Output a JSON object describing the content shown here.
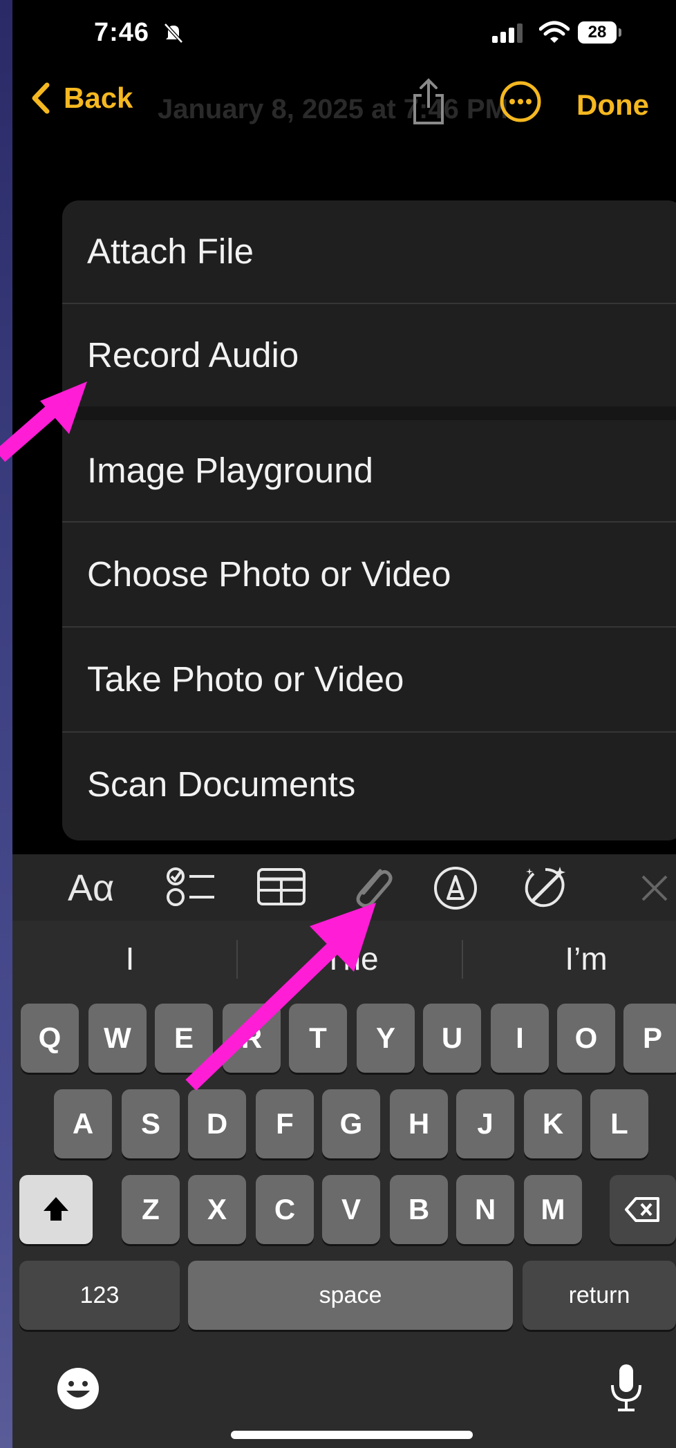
{
  "status_bar": {
    "time": "7:46",
    "battery": "28"
  },
  "nav": {
    "back_label": "Back",
    "title_behind": "January 8, 2025 at 7:46 PM",
    "done_label": "Done"
  },
  "menu": {
    "items": [
      "Attach File",
      "Record Audio",
      "Image Playground",
      "Choose Photo or Video",
      "Take Photo or Video",
      "Scan Documents"
    ]
  },
  "keyboard": {
    "toolbar": {
      "format_label": "Aα",
      "icons": [
        "checklist-icon",
        "table-icon",
        "paperclip-icon",
        "markup-icon",
        "writing-tools-icon",
        "close-icon"
      ]
    },
    "suggestions": [
      "I",
      "The",
      "I’m"
    ],
    "row1": [
      "Q",
      "W",
      "E",
      "R",
      "T",
      "Y",
      "U",
      "I",
      "O",
      "P"
    ],
    "row2": [
      "A",
      "S",
      "D",
      "F",
      "G",
      "H",
      "J",
      "K",
      "L"
    ],
    "row3": [
      "Z",
      "X",
      "C",
      "V",
      "B",
      "N",
      "M"
    ],
    "numbers_label": "123",
    "space_label": "space",
    "return_label": "return"
  },
  "colors": {
    "accent": "#f5b820",
    "annotation_arrow": "#ff1dd6"
  }
}
